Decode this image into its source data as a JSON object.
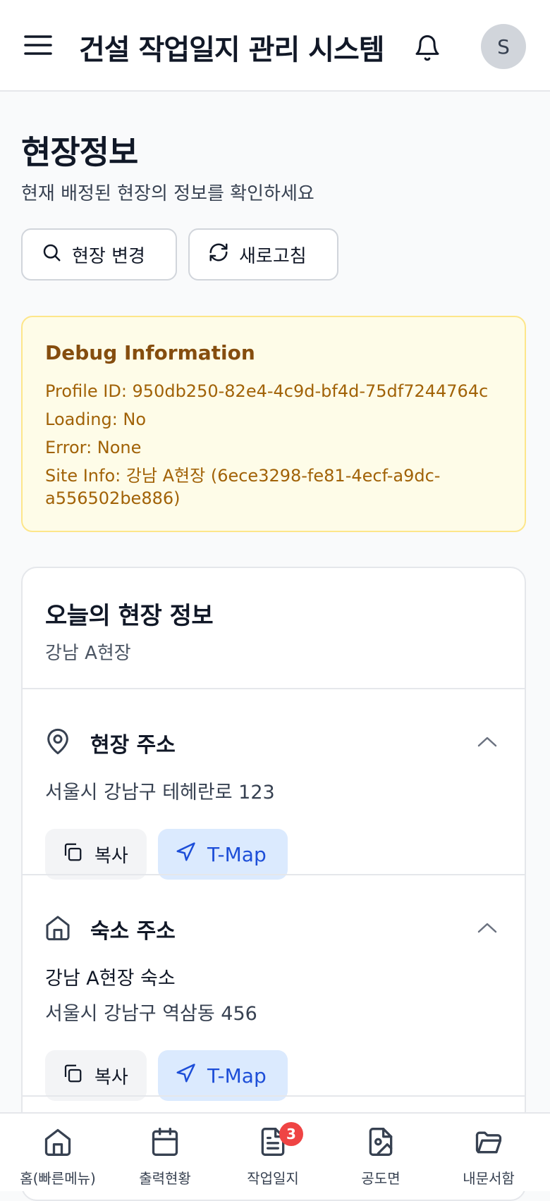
{
  "header": {
    "title": "건설 작업일지 관리 시스템",
    "avatar_initial": "S"
  },
  "page": {
    "title": "현장정보",
    "subtitle": "현재 배정된 현장의 정보를 확인하세요"
  },
  "actions": {
    "change_site": "현장 변경",
    "refresh": "새로고침"
  },
  "debug": {
    "title": "Debug Information",
    "profile_id": "Profile ID: 950db250-82e4-4c9d-bf4d-75df7244764c",
    "loading": "Loading: No",
    "error": "Error: None",
    "site_info_line1": "Site Info: 강남 A현장 (6ece3298-fe81-4ecf-a9dc-",
    "site_info_line2": "a556502be886)"
  },
  "site_card": {
    "title": "오늘의 현장 정보",
    "site_name": "강남 A현장",
    "site_address": {
      "label": "현장 주소",
      "address": "서울시 강남구 테헤란로 123",
      "copy": "복사",
      "tmap": "T-Map"
    },
    "lodging_address": {
      "label": "숙소 주소",
      "name": "강남 A현장 숙소",
      "address": "서울시 강남구 역삼동 456",
      "copy": "복사",
      "tmap": "T-Map"
    }
  },
  "bottom_nav": {
    "items": [
      {
        "label": "홈(빠른메뉴)",
        "icon": "home-icon"
      },
      {
        "label": "출력현황",
        "icon": "calendar-icon"
      },
      {
        "label": "작업일지",
        "icon": "document-icon",
        "badge": "3"
      },
      {
        "label": "공도면",
        "icon": "image-file-icon"
      },
      {
        "label": "내문서함",
        "icon": "folder-icon"
      }
    ]
  }
}
